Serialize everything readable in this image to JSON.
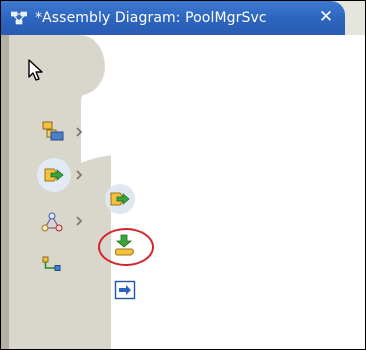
{
  "editor": {
    "tab_title": "*Assembly Diagram: PoolMgrSvc",
    "close_symbol": "✕",
    "tab_icon": "assembly-diagram-icon"
  },
  "palette": {
    "tools": [
      {
        "name": "selection-tool",
        "icon": "arrow-pointer-icon"
      },
      {
        "name": "components-drawer",
        "icon": "components-icon"
      },
      {
        "name": "import-export-drawer",
        "icon": "export-import-icon"
      },
      {
        "name": "diagram-shapes-drawer",
        "icon": "triangle-nodes-icon"
      },
      {
        "name": "wiring-tool",
        "icon": "wire-connection-icon"
      }
    ],
    "flyout": [
      {
        "name": "export-tool",
        "icon": "export-arrow-icon"
      },
      {
        "name": "import-tool",
        "icon": "import-down-arrow-icon",
        "highlighted": true
      },
      {
        "name": "standalone-reference-tool",
        "icon": "reference-arrow-icon"
      }
    ]
  },
  "colors": {
    "tab_blue": "#2c64bd",
    "palette_gray": "#d9d6cc",
    "highlight_ring": "#d4242b"
  }
}
